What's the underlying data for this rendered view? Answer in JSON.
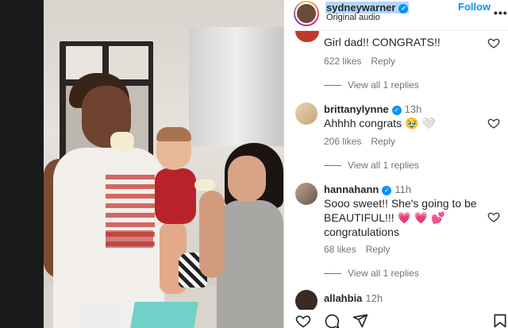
{
  "header": {
    "username": "sydneywarner",
    "subtitle": "Original audio",
    "follow_label": "Follow",
    "more_label": "•••"
  },
  "comments": [
    {
      "text": "Girl dad!! CONGRATS!!",
      "likes": "622 likes",
      "reply": "Reply",
      "view_replies": "View all 1 replies"
    },
    {
      "username": "brittanylynne",
      "time": "13h",
      "text": "Ahhhh congrats 🥹 🤍",
      "likes": "206 likes",
      "reply": "Reply",
      "view_replies": "View all 1 replies"
    },
    {
      "username": "hannahann",
      "time": "11h",
      "text_line1": "Sooo sweet!! She's going to be",
      "text_line2": "BEAUTIFUL!!! 💗 💗 💕",
      "text_line3": "congratulations",
      "likes": "68 likes",
      "reply": "Reply",
      "view_replies": "View all 1 replies"
    },
    {
      "username": "allahbia",
      "time": "12h"
    }
  ],
  "icons": {
    "verified": "verified-badge-icon",
    "heart": "heart-outline-icon",
    "comment": "comment-icon",
    "share": "share-icon",
    "save": "bookmark-icon"
  },
  "colors": {
    "accent": "#0095f6",
    "meta": "#737373",
    "text": "#262626"
  }
}
